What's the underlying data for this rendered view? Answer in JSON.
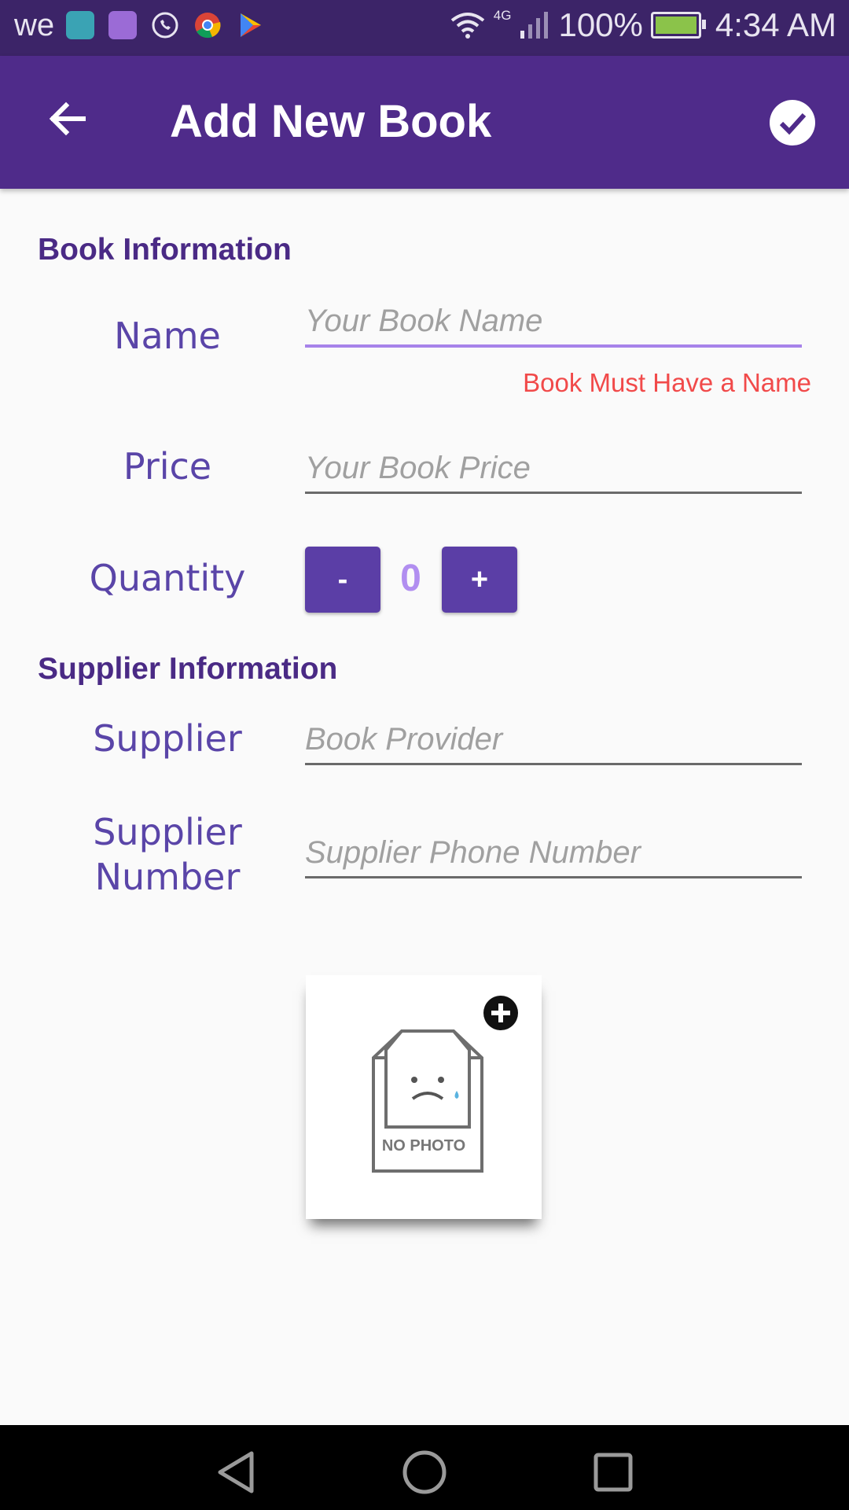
{
  "status_bar": {
    "carrier": "we",
    "network": "4G",
    "battery": "100%",
    "battery_level": 1.0,
    "time": "4:34 AM",
    "notification_icons": [
      "android-icon",
      "gallery-icon",
      "whatsapp-icon",
      "chrome-icon",
      "play-store-icon"
    ]
  },
  "app_bar": {
    "title": "Add New Book",
    "back_icon": "arrow-back-icon",
    "done_icon": "check-circle-icon",
    "background": "#4f2b8a"
  },
  "book_info": {
    "title": "Book Information",
    "name": {
      "label": "Name",
      "value": "",
      "placeholder": "Your Book Name",
      "error": "Book Must Have a Name"
    },
    "price": {
      "label": "Price",
      "value": "",
      "placeholder": "Your Book Price"
    },
    "quantity": {
      "label": "Quantity",
      "minus_label": "-",
      "plus_label": "+",
      "value": "0"
    }
  },
  "supplier_info": {
    "title": "Supplier Information",
    "supplier": {
      "label": "Supplier",
      "value": "",
      "placeholder": "Book Provider"
    },
    "supplier_number": {
      "label_line1": "Supplier",
      "label_line2": "Number",
      "value": "",
      "placeholder": "Supplier Phone Number"
    }
  },
  "photo": {
    "no_photo_text": "NO PHOTO",
    "add_icon": "add-circle-icon"
  },
  "nav_bar": {
    "icons": [
      "back-triangle-icon",
      "home-circle-icon",
      "recents-square-icon"
    ]
  },
  "colors": {
    "primary": "#4f2b8a",
    "status_bar": "#3c2468",
    "accent": "#a783ea",
    "label": "#5a45a8",
    "error": "#f14a4a",
    "button": "#5b3ea6"
  }
}
